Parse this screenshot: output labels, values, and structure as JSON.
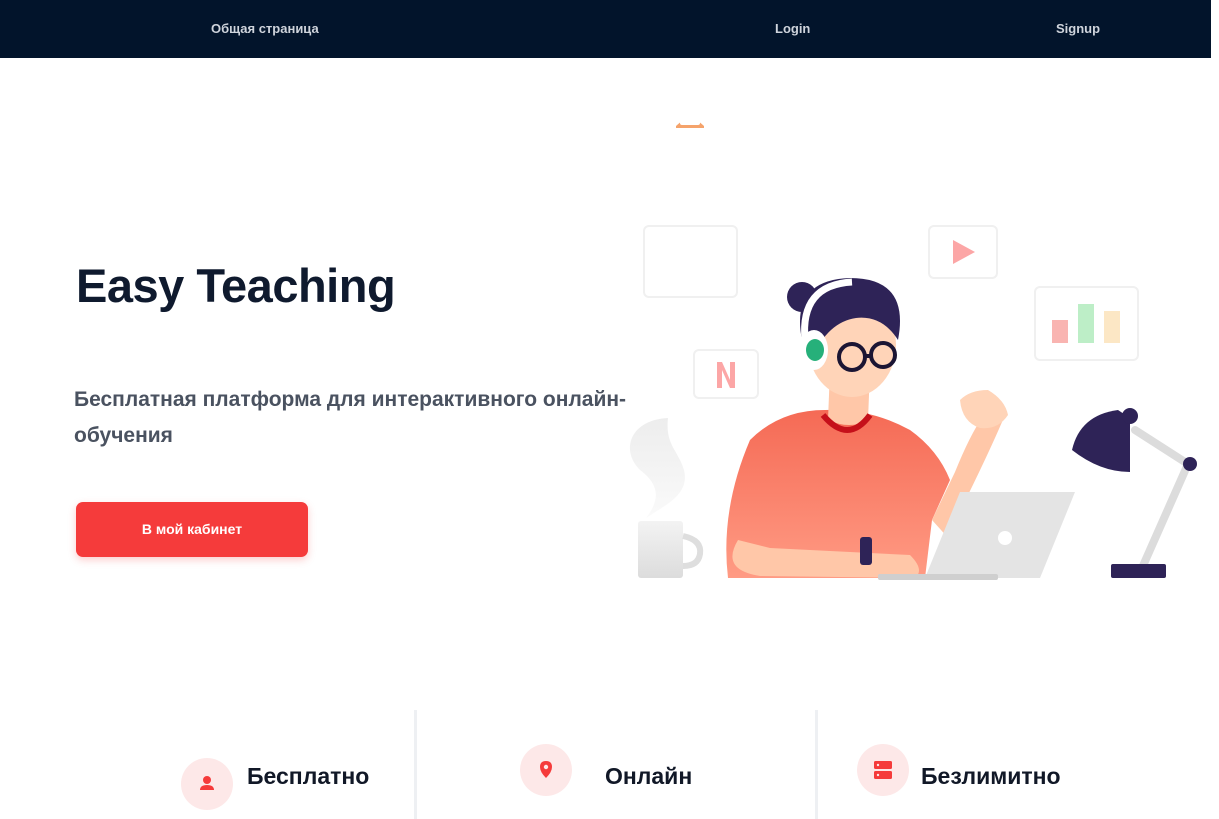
{
  "nav": {
    "general_label": "Общая страница",
    "login_label": "Login",
    "signup_label": "Signup"
  },
  "hero": {
    "title": "Easy Teaching",
    "subtitle": "Бесплатная платформа для интерактивного онлайн-обучения",
    "cta_label": "В мой кабинет"
  },
  "features": [
    {
      "label": "Бесплатно",
      "icon": "user-icon"
    },
    {
      "label": "Онлайн",
      "icon": "location-pin-icon"
    },
    {
      "label": "Безлимитно",
      "icon": "server-icon"
    }
  ],
  "colors": {
    "navbar_bg": "#02142b",
    "accent": "#f53b3b",
    "icon_bg": "#fde8e8",
    "title_text": "#0f1a2e"
  }
}
